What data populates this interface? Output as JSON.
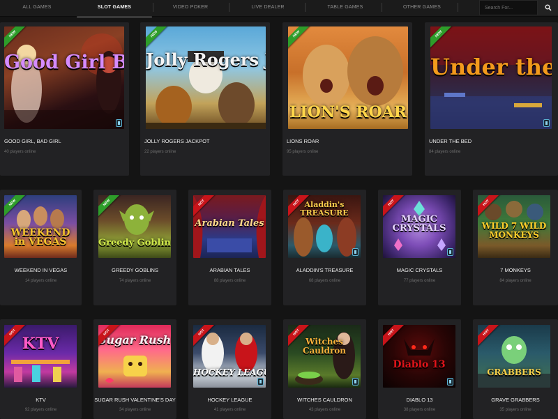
{
  "nav": {
    "tabs": [
      {
        "label": "ALL GAMES"
      },
      {
        "label": "SLOT GAMES"
      },
      {
        "label": "VIDEO POKER"
      },
      {
        "label": "LIVE DEALER"
      },
      {
        "label": "TABLE GAMES"
      },
      {
        "label": "OTHER GAMES"
      }
    ],
    "active_tab": "SLOT GAMES",
    "search_placeholder": "Search For...",
    "search_icon": "magnifier-icon"
  },
  "colors": {
    "background": "#141414",
    "card": "#222224",
    "badge_new": "#2e9d2a",
    "badge_hot": "#c8141a",
    "players_text": "#6e6e6e"
  },
  "games": [
    {
      "title": "GOOD GIRL, BAD GIRL",
      "players": "40 players online",
      "badge": "NEW",
      "art_text": "Good Girl Bad Girl",
      "mobile": true
    },
    {
      "title": "JOLLY ROGERS JACKPOT",
      "players": "22 players online",
      "badge": "NEW",
      "art_text": "Jolly Rogers JACKPOT!",
      "mobile": false
    },
    {
      "title": "LIONS ROAR",
      "players": "95 players online",
      "badge": "NEW",
      "art_text": "LION'S ROAR",
      "mobile": false
    },
    {
      "title": "UNDER THE BED",
      "players": "84 players online",
      "badge": "NEW",
      "art_text": "Under the Bed",
      "mobile": true
    },
    {
      "title": "WEEKEND IN VEGAS",
      "players": "14 players online",
      "badge": "NEW",
      "art_text": "WEEKEND in VEGAS",
      "mobile": false
    },
    {
      "title": "GREEDY GOBLINS",
      "players": "74 players online",
      "badge": "NEW",
      "art_text": "Greedy Goblins",
      "mobile": false
    },
    {
      "title": "ARABIAN TALES",
      "players": "88 players online",
      "badge": "HOT",
      "art_text": "Arabian Tales",
      "mobile": false
    },
    {
      "title": "ALADDIN'S TREASURE",
      "players": "68 players online",
      "badge": "HOT",
      "art_text": "Aladdin's TREASURE",
      "mobile": true
    },
    {
      "title": "MAGIC CRYSTALS",
      "players": "77 players online",
      "badge": "HOT",
      "art_text": "MAGIC CRYSTALS",
      "mobile": true
    },
    {
      "title": "7 MONKEYS",
      "players": "84 players online",
      "badge": "HOT",
      "art_text": "WILD 7 WILD MONKEYS",
      "mobile": false
    },
    {
      "title": "KTV",
      "players": "92 players online",
      "badge": "HOT",
      "art_text": "KTV",
      "mobile": false
    },
    {
      "title": "SUGAR RUSH VALENTINE'S DAY",
      "players": "34 players online",
      "badge": "HOT",
      "art_text": "Sugar Rush",
      "mobile": false
    },
    {
      "title": "HOCKEY LEAGUE",
      "players": "41 players online",
      "badge": "HOT",
      "art_text": "HOCKEY LEAGUE",
      "mobile": true
    },
    {
      "title": "WITCHES CAULDRON",
      "players": "43 players online",
      "badge": "HOT",
      "art_text": "Witches Cauldron",
      "mobile": true
    },
    {
      "title": "DIABLO 13",
      "players": "38 players online",
      "badge": "HOT",
      "art_text": "Diablo 13",
      "mobile": true
    },
    {
      "title": "GRAVE GRABBERS",
      "players": "35 players online",
      "badge": "HOT",
      "art_text": "GRABBERS",
      "mobile": false
    }
  ]
}
